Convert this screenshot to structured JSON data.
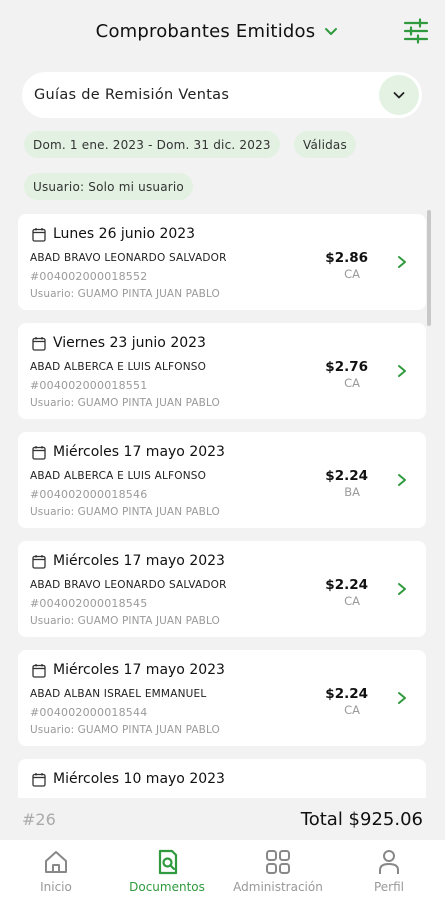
{
  "header": {
    "title": "Comprobantes Emitidos",
    "title_icon": "chevron-down-icon",
    "filter_icon": "sliders-icon"
  },
  "select": {
    "value": "Guías de Remisión Ventas",
    "icon": "chevron-down-icon"
  },
  "chips": {
    "date_range": "Dom. 1 ene. 2023 - Dom. 31 dic. 2023",
    "status": "Válidas",
    "user": "Usuario: Solo mi usuario"
  },
  "cards": [
    {
      "date": "Lunes 26 junio 2023",
      "name": "ABAD BRAVO LEONARDO SALVADOR",
      "number": "#004002000018552",
      "user": "Usuario:  GUAMO PINTA JUAN PABLO",
      "amount": "$2.86",
      "code": "CA"
    },
    {
      "date": "Viernes 23 junio 2023",
      "name": "ABAD ALBERCA E LUIS ALFONSO",
      "number": "#004002000018551",
      "user": "Usuario:  GUAMO PINTA JUAN PABLO",
      "amount": "$2.76",
      "code": "CA"
    },
    {
      "date": "Miércoles 17 mayo 2023",
      "name": "ABAD ALBERCA E LUIS ALFONSO",
      "number": "#004002000018546",
      "user": "Usuario:  GUAMO PINTA JUAN PABLO",
      "amount": "$2.24",
      "code": "BA"
    },
    {
      "date": "Miércoles 17 mayo 2023",
      "name": "ABAD BRAVO LEONARDO SALVADOR",
      "number": "#004002000018545",
      "user": "Usuario:  GUAMO PINTA JUAN PABLO",
      "amount": "$2.24",
      "code": "CA"
    },
    {
      "date": "Miércoles 17 mayo 2023",
      "name": "ABAD ALBAN ISRAEL EMMANUEL",
      "number": "#004002000018544",
      "user": "Usuario:  GUAMO PINTA JUAN PABLO",
      "amount": "$2.24",
      "code": "CA"
    },
    {
      "date": "Miércoles 10 mayo 2023",
      "name": "",
      "number": "",
      "user": "",
      "amount": "",
      "code": ""
    }
  ],
  "footer": {
    "count": "#26",
    "total": "Total $925.06"
  },
  "nav": [
    {
      "label": "Inicio",
      "icon": "home-icon",
      "active": false
    },
    {
      "label": "Documentos",
      "icon": "document-search-icon",
      "active": true
    },
    {
      "label": "Administración",
      "icon": "grid-icon",
      "active": false
    },
    {
      "label": "Perfil",
      "icon": "person-icon",
      "active": false
    }
  ],
  "colors": {
    "accent": "#2f9a3e",
    "chip_bg": "#e2f1e2",
    "background": "#f2f2f2"
  }
}
